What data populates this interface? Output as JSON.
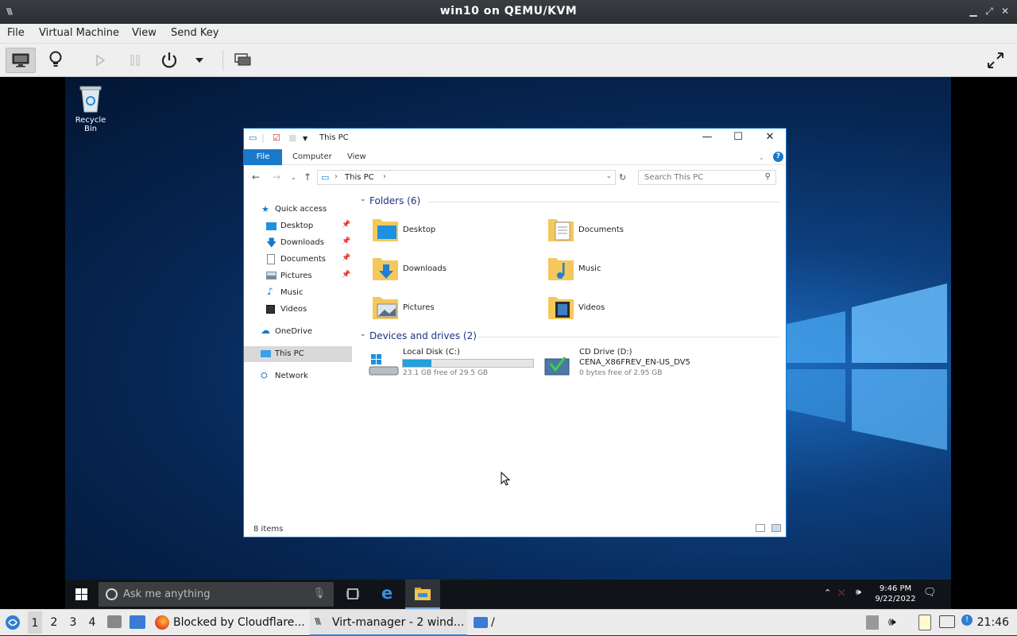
{
  "window": {
    "title": "win10 on QEMU/KVM"
  },
  "menu": {
    "items": [
      "File",
      "Virtual Machine",
      "View",
      "Send Key"
    ]
  },
  "desktop": {
    "recycle_bin": "Recycle Bin"
  },
  "explorer": {
    "title": "This PC",
    "ribbon_tabs": {
      "file": "File",
      "computer": "Computer",
      "view": "View"
    },
    "address": "This PC",
    "search_placeholder": "Search This PC",
    "nav": {
      "quick_access": "Quick access",
      "desktop": "Desktop",
      "downloads": "Downloads",
      "documents": "Documents",
      "pictures": "Pictures",
      "music": "Music",
      "videos": "Videos",
      "onedrive": "OneDrive",
      "this_pc": "This PC",
      "network": "Network"
    },
    "folders_header": "Folders (6)",
    "folders": {
      "desktop": "Desktop",
      "documents": "Documents",
      "downloads": "Downloads",
      "music": "Music",
      "pictures": "Pictures",
      "videos": "Videos"
    },
    "devices_header": "Devices and drives (2)",
    "drives": {
      "c_name": "Local Disk (C:)",
      "c_free": "23.1 GB free of 29.5 GB",
      "c_used_fraction": 0.22,
      "d_name": "CD Drive (D:)",
      "d_label": "CENA_X86FREV_EN-US_DV5",
      "d_free": "0 bytes free of 2.95 GB"
    },
    "status": "8 items"
  },
  "guest_taskbar": {
    "search_placeholder": "Ask me anything",
    "time": "9:46 PM",
    "date": "9/22/2022"
  },
  "host_panel": {
    "workspaces": [
      "1",
      "2",
      "3",
      "4"
    ],
    "tasks": {
      "firefox": "Blocked by Cloudflare...",
      "virt": "Virt-manager - 2 wind...",
      "files": "/"
    },
    "clock": "21:46"
  },
  "colors": {
    "accent": "#1979ca",
    "desktop": "#0d3f7d",
    "drive_bar": "#26a0da"
  }
}
